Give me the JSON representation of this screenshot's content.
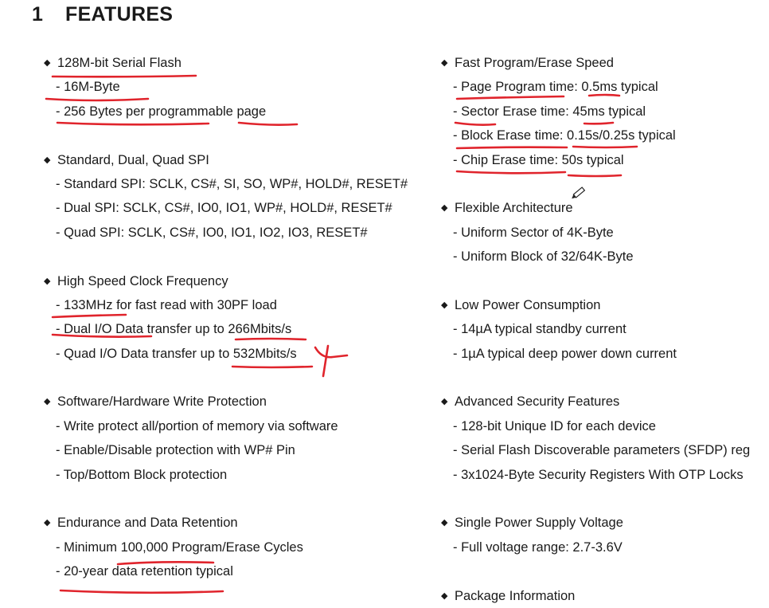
{
  "heading": {
    "number": "1",
    "title": "FEATURES"
  },
  "left_column": [
    {
      "title": "128M-bit Serial Flash",
      "items": [
        "- 16M-Byte",
        "- 256 Bytes per programmable page"
      ]
    },
    {
      "title": "Standard, Dual, Quad SPI",
      "items": [
        "- Standard SPI: SCLK, CS#, SI, SO, WP#, HOLD#, RESET#",
        "- Dual SPI: SCLK, CS#, IO0, IO1, WP#, HOLD#, RESET#",
        "- Quad SPI: SCLK, CS#, IO0, IO1, IO2, IO3, RESET#"
      ]
    },
    {
      "title": "High Speed Clock Frequency",
      "items": [
        "- 133MHz for fast read with 30PF load",
        "- Dual I/O Data transfer up to 266Mbits/s",
        "- Quad I/O Data transfer up to 532Mbits/s"
      ]
    },
    {
      "title": "Software/Hardware Write Protection",
      "items": [
        "- Write protect all/portion of memory via software",
        "- Enable/Disable protection with WP# Pin",
        "- Top/Bottom Block protection"
      ]
    },
    {
      "title": "Endurance and Data Retention",
      "items": [
        "- Minimum 100,000 Program/Erase Cycles",
        "- 20-year data retention typical"
      ]
    }
  ],
  "right_column": [
    {
      "title": "Fast Program/Erase Speed",
      "items": [
        "- Page Program time: 0.5ms typical",
        "- Sector Erase time: 45ms typical",
        "- Block Erase time: 0.15s/0.25s typical",
        "- Chip Erase time: 50s typical"
      ]
    },
    {
      "title": "Flexible Architecture",
      "items": [
        "- Uniform Sector of 4K-Byte",
        "- Uniform Block of 32/64K-Byte"
      ]
    },
    {
      "title": "Low Power Consumption",
      "items": [
        "- 14µA typical standby current",
        "- 1µA typical deep power down current"
      ]
    },
    {
      "title": "Advanced Security Features",
      "items": [
        "- 128-bit Unique ID for each device",
        "- Serial Flash Discoverable parameters (SFDP) reg",
        "- 3x1024-Byte Security Registers With OTP Locks"
      ]
    },
    {
      "title": "Single Power Supply Voltage",
      "items": [
        "- Full voltage range: 2.7-3.6V"
      ]
    },
    {
      "title": "Package Information",
      "items": []
    }
  ],
  "bullet_glyph": "◆",
  "annotation_color": "#e0242c"
}
